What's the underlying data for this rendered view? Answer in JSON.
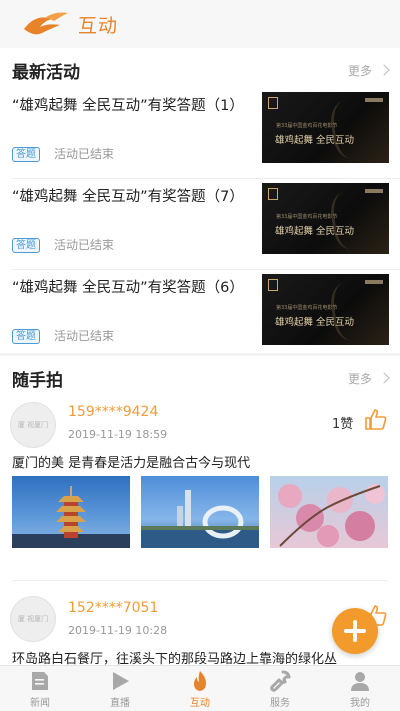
{
  "header": {
    "title": "互动",
    "logo_icon": "dragon-logo-icon"
  },
  "activities": {
    "section_title": "最新活动",
    "more_label": "更多",
    "items": [
      {
        "title": "“雄鸡起舞 全民互动”有奖答题（1）",
        "tag": "答题",
        "status": "活动已结束"
      },
      {
        "title": "“雄鸡起舞 全民互动”有奖答题（7）",
        "tag": "答题",
        "status": "活动已结束"
      },
      {
        "title": "“雄鸡起舞 全民互动”有奖答题（6）",
        "tag": "答题",
        "status": "活动已结束"
      }
    ],
    "thumb_text": {
      "small": "第33届中国金鸡百花电影节",
      "main": "雄鸡起舞 全民互动"
    }
  },
  "snapshots": {
    "section_title": "随手拍",
    "more_label": "更多",
    "posts": [
      {
        "user": "159****9424",
        "time": "2019-11-19 18:59",
        "likes": "1赞",
        "text": "厦门的美  是青春是活力是融合古今与现代",
        "avatar_text": "厦 视厦门"
      },
      {
        "user": "152****7051",
        "time": "2019-11-19 10:28",
        "text": "环岛路白石餐厅，往溪头下的那段马路边上靠海的绿化丛",
        "avatar_text": "厦 视厦门"
      }
    ]
  },
  "tabbar": {
    "items": [
      {
        "label": "新闻",
        "icon": "news-icon"
      },
      {
        "label": "直播",
        "icon": "live-play-icon"
      },
      {
        "label": "互动",
        "icon": "flame-icon",
        "active": true
      },
      {
        "label": "服务",
        "icon": "wrench-icon"
      },
      {
        "label": "我的",
        "icon": "user-icon"
      }
    ]
  },
  "colors": {
    "accent": "#e8832a",
    "username": "#f29c38",
    "tag": "#4a9bd6"
  }
}
